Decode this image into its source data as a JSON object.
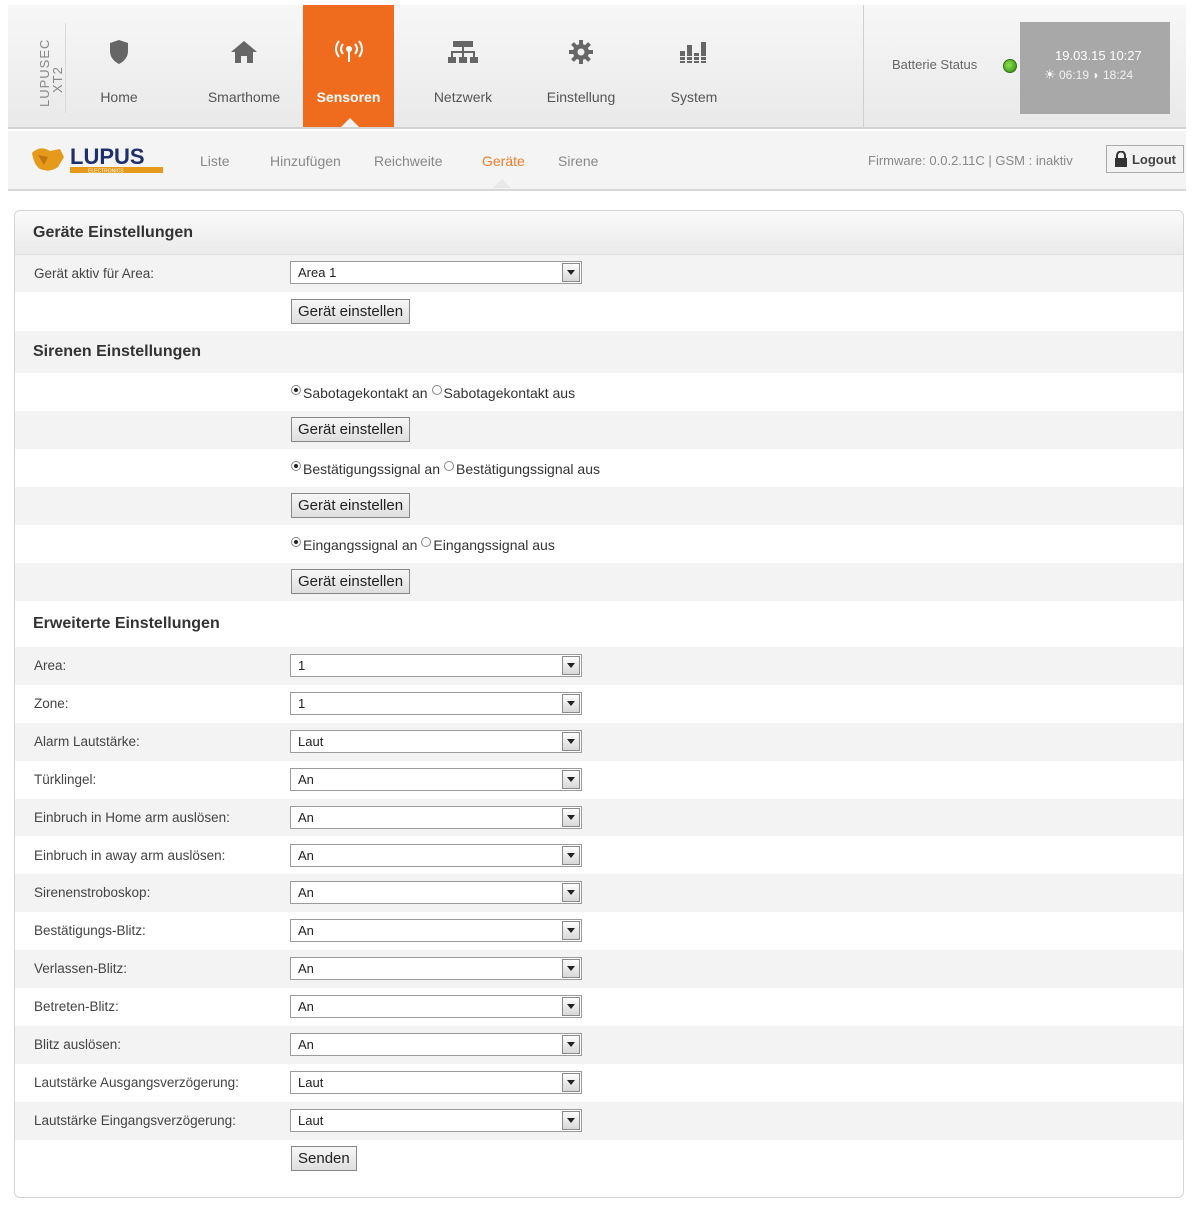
{
  "brand": {
    "line1": "LUPUSEC",
    "line2": "XT2"
  },
  "nav": [
    {
      "label": "Home",
      "icon": "shield-icon"
    },
    {
      "label": "Smarthome",
      "icon": "house-icon"
    },
    {
      "label": "Sensoren",
      "icon": "sensor-signal-icon",
      "active": true
    },
    {
      "label": "Netzwerk",
      "icon": "network-icon"
    },
    {
      "label": "Einstellung",
      "icon": "gear-icon"
    },
    {
      "label": "System",
      "icon": "bar-chart-icon"
    }
  ],
  "status": {
    "battery_label": "Batterie Status",
    "battery_color": "#3a9a1a",
    "datetime": "19.03.15 10:27",
    "sunrise": "06:19",
    "sunset": "18:24"
  },
  "logo": {
    "text": "LUPUS",
    "subtext": "ELECTRONICS"
  },
  "subnav": [
    {
      "label": "Liste"
    },
    {
      "label": "Hinzufügen"
    },
    {
      "label": "Reichweite"
    },
    {
      "label": "Geräte",
      "active": true
    },
    {
      "label": "Sirene"
    }
  ],
  "firmware": "Firmware: 0.0.2.11C | GSM : inaktiv",
  "logout_label": "Logout",
  "colors": {
    "accent": "#ef6c1e",
    "active_subtab": "#ef7d2c"
  },
  "section1": {
    "title": "Geräte Einstellungen",
    "area_label": "Gerät aktiv für Area:",
    "area_value": "Area 1",
    "button": "Gerät einstellen"
  },
  "section2": {
    "title": "Sirenen Einstellungen",
    "radios": [
      {
        "on": "Sabotagekontakt an",
        "off": "Sabotagekontakt aus"
      },
      {
        "on": "Bestätigungssignal an",
        "off": "Bestätigungssignal aus"
      },
      {
        "on": "Eingangssignal an",
        "off": "Eingangssignal aus"
      }
    ],
    "button": "Gerät einstellen"
  },
  "section3": {
    "title": "Erweiterte Einstellungen",
    "fields": [
      {
        "label": "Area:",
        "value": "1"
      },
      {
        "label": "Zone:",
        "value": "1"
      },
      {
        "label": "Alarm Lautstärke:",
        "value": "Laut"
      },
      {
        "label": "Türklingel:",
        "value": "An"
      },
      {
        "label": "Einbruch in Home arm auslösen:",
        "value": "An"
      },
      {
        "label": "Einbruch in away arm auslösen:",
        "value": "An"
      },
      {
        "label": "Sirenenstroboskop:",
        "value": "An"
      },
      {
        "label": "Bestätigungs-Blitz:",
        "value": "An"
      },
      {
        "label": "Verlassen-Blitz:",
        "value": "An"
      },
      {
        "label": "Betreten-Blitz:",
        "value": "An"
      },
      {
        "label": "Blitz auslösen:",
        "value": "An"
      },
      {
        "label": "Lautstärke Ausgangsverzögerung:",
        "value": "Laut"
      },
      {
        "label": "Lautstärke Eingangsverzögerung:",
        "value": "Laut"
      }
    ],
    "submit": "Senden"
  }
}
